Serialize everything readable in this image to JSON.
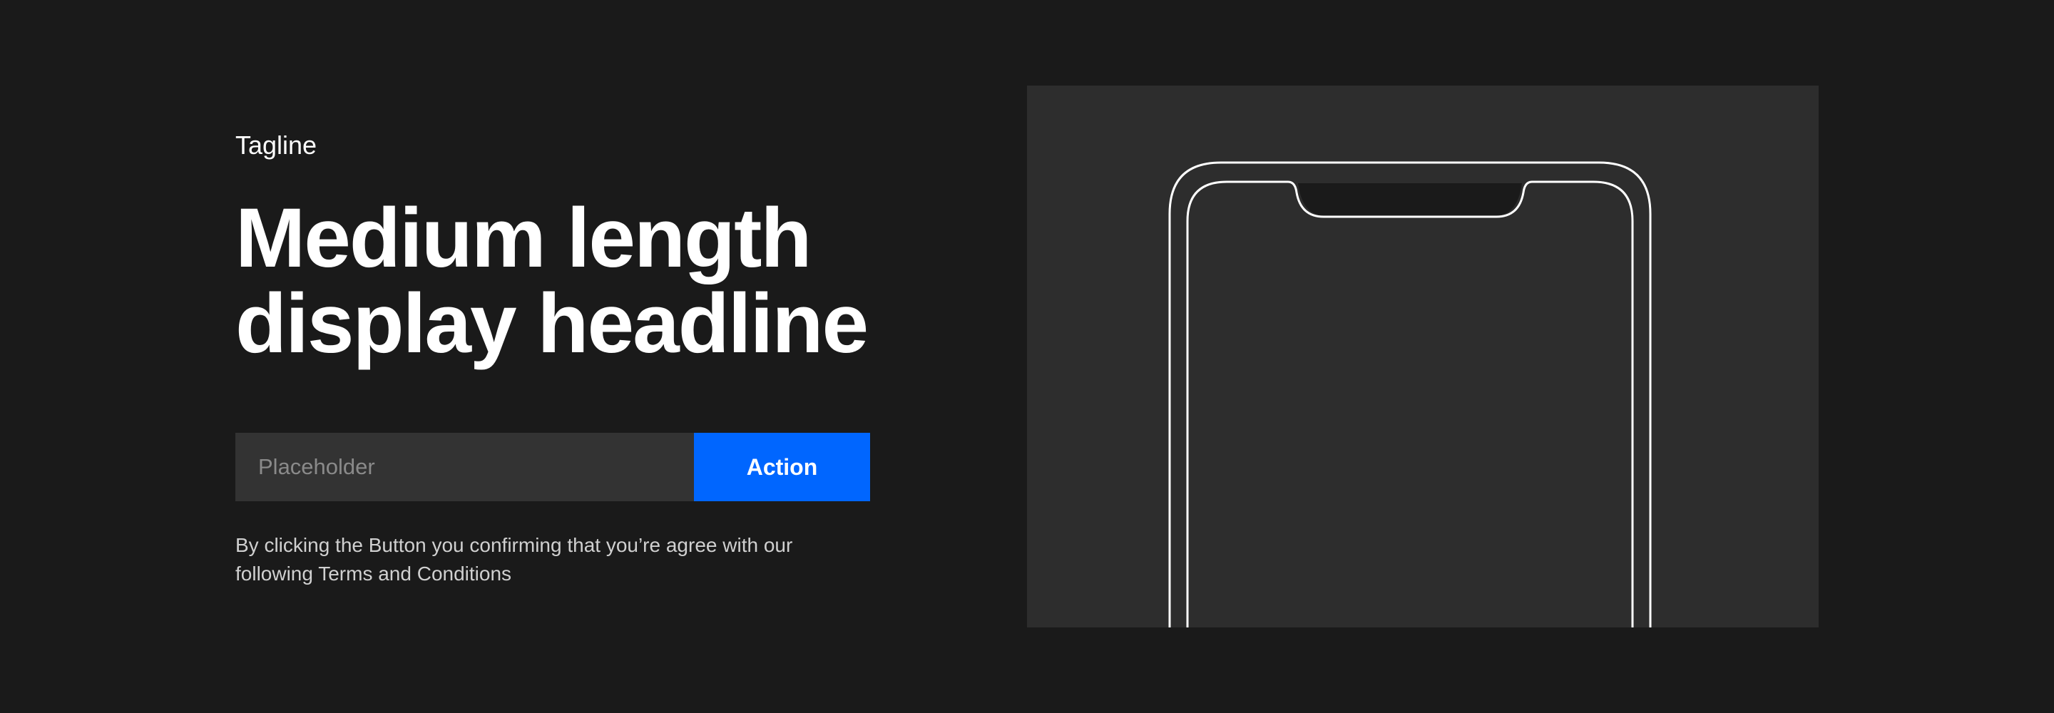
{
  "hero": {
    "tagline": "Tagline",
    "headline_line1": "Medium length",
    "headline_line2": "display headline"
  },
  "form": {
    "placeholder": "Placeholder",
    "action_label": "Action"
  },
  "legal": {
    "line1": "By clicking the Button you confirming that you’re agree with our",
    "line2": "following Terms and Conditions"
  },
  "colors": {
    "background": "#1a1a1a",
    "panel": "#2d2d2d",
    "input": "#333333",
    "accent": "#0066ff",
    "text": "#ffffff"
  },
  "icons": {
    "device": "phone-outline-icon"
  }
}
